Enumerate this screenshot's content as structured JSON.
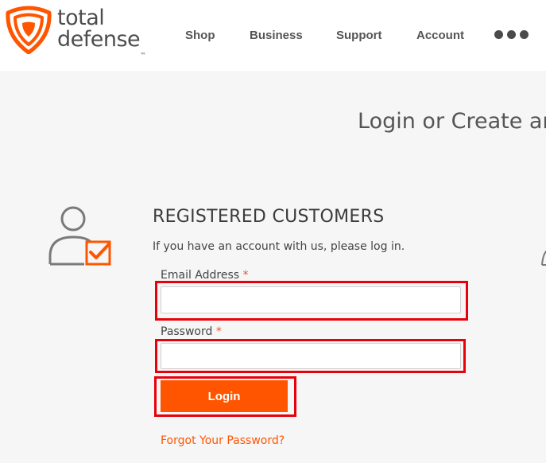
{
  "brand": {
    "logo_line1": "total",
    "logo_line2": "defense",
    "trademark": "™",
    "accent_color": "#ff5500"
  },
  "nav": {
    "items": [
      {
        "label": "Shop"
      },
      {
        "label": "Business"
      },
      {
        "label": "Support"
      },
      {
        "label": "Account"
      }
    ],
    "more_icon": "more-dots-icon"
  },
  "page": {
    "title": "Login or Create ar"
  },
  "registered": {
    "icon": "user-checkbox-icon",
    "heading": "REGISTERED CUSTOMERS",
    "intro": "If you have an account with us, please log in.",
    "email_label": "Email Address",
    "password_label": "Password",
    "required_mark": "*",
    "email_value": "",
    "password_value": "",
    "login_label": "Login",
    "forgot_label": "Forgot Your Password?"
  },
  "highlight_color": "#e8000b"
}
